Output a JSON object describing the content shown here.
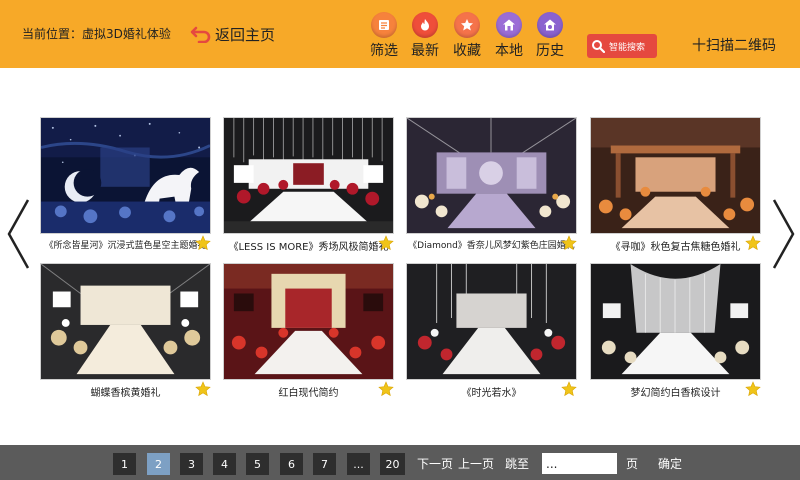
{
  "header": {
    "location": "当前位置：虚拟3D婚礼体验",
    "back_label": "返回主页",
    "nav": [
      {
        "label": "筛选",
        "icon": "filter-icon",
        "color": "#f6823c"
      },
      {
        "label": "最新",
        "icon": "flame-icon",
        "color": "#ef4e3a"
      },
      {
        "label": "收藏",
        "icon": "star-icon",
        "color": "#f5734a"
      },
      {
        "label": "本地",
        "icon": "home-icon",
        "color": "#9b6dd6"
      },
      {
        "label": "历史",
        "icon": "history-icon",
        "color": "#8a62cf"
      }
    ],
    "search_label": "智能搜索",
    "scan_label": "十扫描二维码"
  },
  "cards": [
    {
      "title": "《所念皆星河》沉浸式蓝色星空主题婚礼",
      "theme": "starry-blue"
    },
    {
      "title": "《LESS IS MORE》秀场风极简婚礼",
      "theme": "red-white"
    },
    {
      "title": "《Diamond》香奈儿风梦幻紫色庄园婚礼",
      "theme": "purple"
    },
    {
      "title": "《寻咖》秋色复古焦糖色婚礼",
      "theme": "caramel"
    },
    {
      "title": "蝴蝶香槟黄婚礼",
      "theme": "champagne"
    },
    {
      "title": "红白现代简约",
      "theme": "red-white-modern"
    },
    {
      "title": "《时光若水》",
      "theme": "white-red"
    },
    {
      "title": "梦幻简约白香槟设计",
      "theme": "white-champagne"
    }
  ],
  "pagination": {
    "pages": [
      "1",
      "2",
      "3",
      "4",
      "5",
      "6",
      "7",
      "...",
      "20"
    ],
    "current": "2",
    "next_label": "下一页",
    "prev_label": "上一页",
    "jump_label": "跳至",
    "jump_value": "...",
    "page_unit": "页",
    "confirm_label": "确定"
  },
  "colors": {
    "header_bg": "#f7a928",
    "footer_bg": "#5b5b5b",
    "page_active": "#7da0c4",
    "search_bg": "#e5493f",
    "star": "#f0c419"
  }
}
